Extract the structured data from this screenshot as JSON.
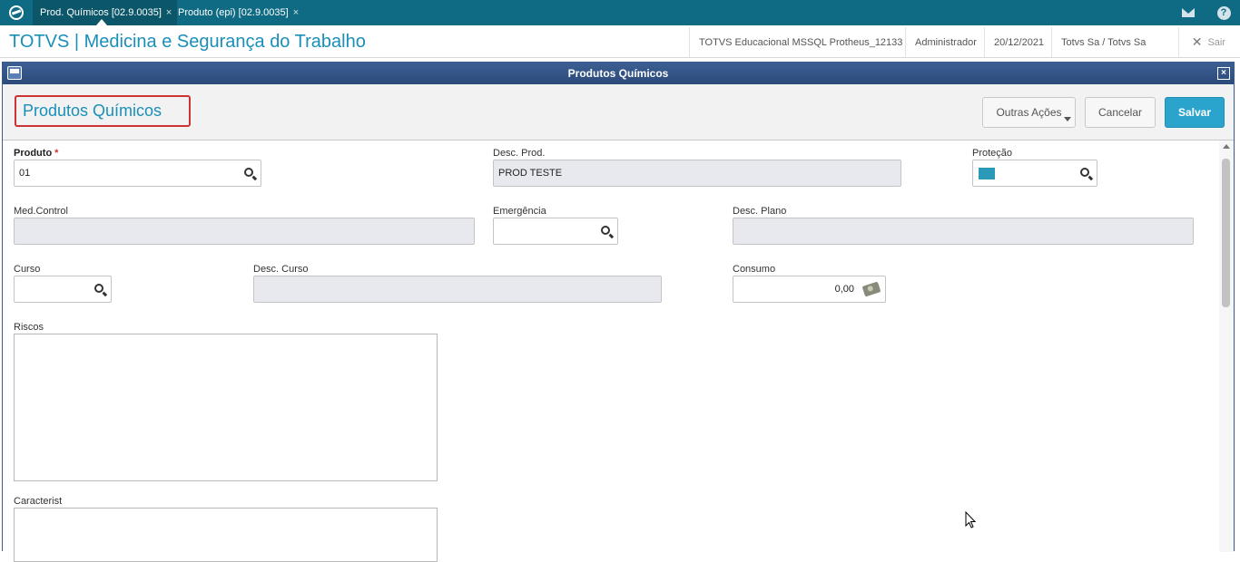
{
  "topbar": {
    "tabs": [
      {
        "label": "Prod. Químicos [02.9.0035]",
        "close": "×"
      },
      {
        "label": "Produto (epi) [02.9.0035]",
        "close": "×"
      }
    ],
    "help_glyph": "?"
  },
  "header": {
    "app_title": "TOTVS | Medicina e Segurança do Trabalho",
    "environment": "TOTVS Educacional MSSQL Protheus_12133",
    "user": "Administrador",
    "date": "20/12/2021",
    "company": "Totvs Sa / Totvs Sa",
    "logout": "Sair",
    "logout_glyph": "✕"
  },
  "dialog": {
    "title": "Produtos Químicos",
    "close_glyph": "×",
    "form_title": "Produtos Químicos",
    "buttons": {
      "other_actions": "Outras Ações",
      "cancel": "Cancelar",
      "save": "Salvar"
    }
  },
  "form": {
    "produto": {
      "label": "Produto",
      "required_mark": "*",
      "value": "01"
    },
    "desc_prod": {
      "label": "Desc. Prod.",
      "value": "PROD TESTE"
    },
    "protecao": {
      "label": "Proteção",
      "swatch_color": "#2a9ab8"
    },
    "med_control": {
      "label": "Med.Control",
      "value": ""
    },
    "emergencia": {
      "label": "Emergência",
      "value": ""
    },
    "desc_plano": {
      "label": "Desc. Plano",
      "value": ""
    },
    "curso": {
      "label": "Curso",
      "value": ""
    },
    "desc_curso": {
      "label": "Desc. Curso",
      "value": ""
    },
    "consumo": {
      "label": "Consumo",
      "value": "0,00"
    },
    "riscos": {
      "label": "Riscos",
      "value": ""
    },
    "caracterist": {
      "label": "Caracterist",
      "value": ""
    }
  },
  "colors": {
    "topbar": "#0f6b84",
    "accent": "#1a8fb8",
    "save_button": "#2aa4cc",
    "dialog_title": "#2c4a7a",
    "required": "#cc3333"
  }
}
